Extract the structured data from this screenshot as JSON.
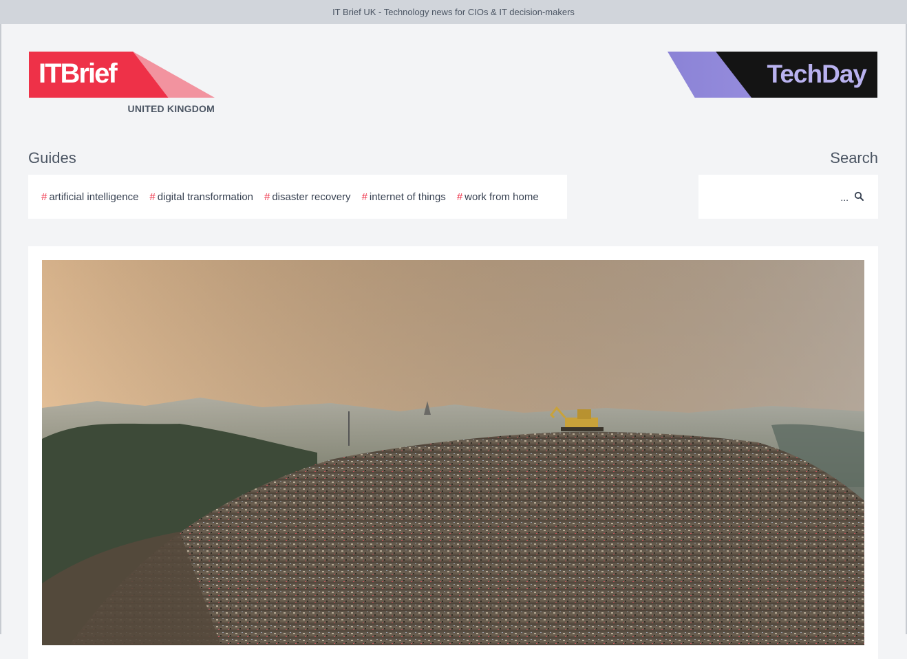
{
  "window": {
    "title": "IT Brief UK - Technology news for CIOs & IT decision-makers"
  },
  "logo": {
    "brand": "ITBrief",
    "region": "UNITED KINGDOM",
    "color": "#ee3148"
  },
  "partner_logo": {
    "brand": "TechDay",
    "color": "#141414"
  },
  "guides": {
    "label": "Guides",
    "items": [
      {
        "hash": "#",
        "label": "artificial intelligence"
      },
      {
        "hash": "#",
        "label": "digital transformation"
      },
      {
        "hash": "#",
        "label": "disaster recovery"
      },
      {
        "hash": "#",
        "label": "internet of things"
      },
      {
        "hash": "#",
        "label": "work from home"
      }
    ]
  },
  "search": {
    "label": "Search",
    "placeholder": "...",
    "icon": "search-icon"
  },
  "hero": {
    "image": "landfill-with-excavator-photo"
  }
}
